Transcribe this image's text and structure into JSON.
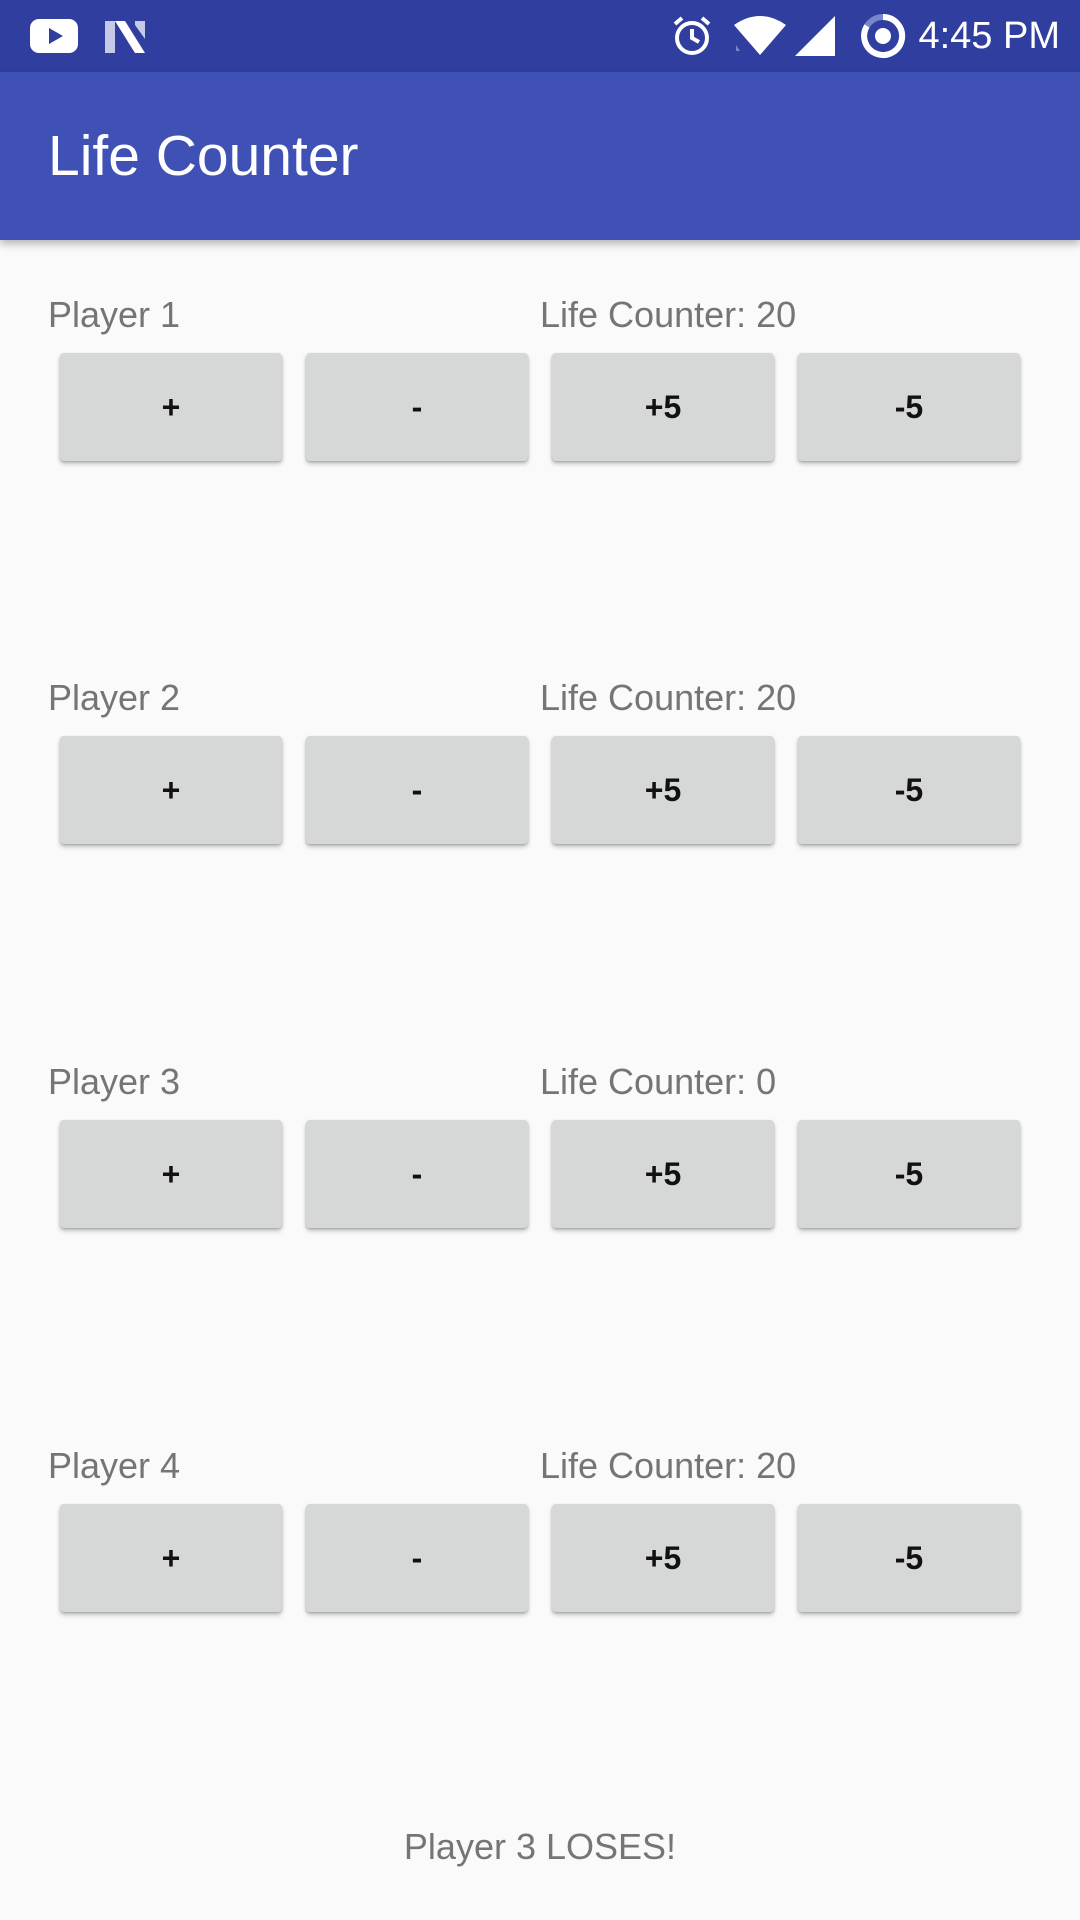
{
  "status_bar": {
    "time": "4:45 PM",
    "icons": [
      "youtube-icon",
      "n-logo-icon",
      "alarm-icon",
      "wifi-icon",
      "signal-icon",
      "sync-icon"
    ]
  },
  "app_bar": {
    "title": "Life Counter"
  },
  "players": [
    {
      "name": "Player 1",
      "life_label": "Life Counter: 20",
      "buttons": {
        "plus": "+",
        "minus": "-",
        "plus5": "+5",
        "minus5": "-5"
      }
    },
    {
      "name": "Player 2",
      "life_label": "Life Counter: 20",
      "buttons": {
        "plus": "+",
        "minus": "-",
        "plus5": "+5",
        "minus5": "-5"
      }
    },
    {
      "name": "Player 3",
      "life_label": "Life Counter: 0",
      "buttons": {
        "plus": "+",
        "minus": "-",
        "plus5": "+5",
        "minus5": "-5"
      }
    },
    {
      "name": "Player 4",
      "life_label": "Life Counter: 20",
      "buttons": {
        "plus": "+",
        "minus": "-",
        "plus5": "+5",
        "minus5": "-5"
      }
    }
  ],
  "result_message": "Player 3 LOSES!",
  "colors": {
    "status_bar": "#303f9f",
    "app_bar": "#3f51b5",
    "background": "#fafafa",
    "button": "#d6d7d7",
    "secondary_text": "#757575"
  }
}
